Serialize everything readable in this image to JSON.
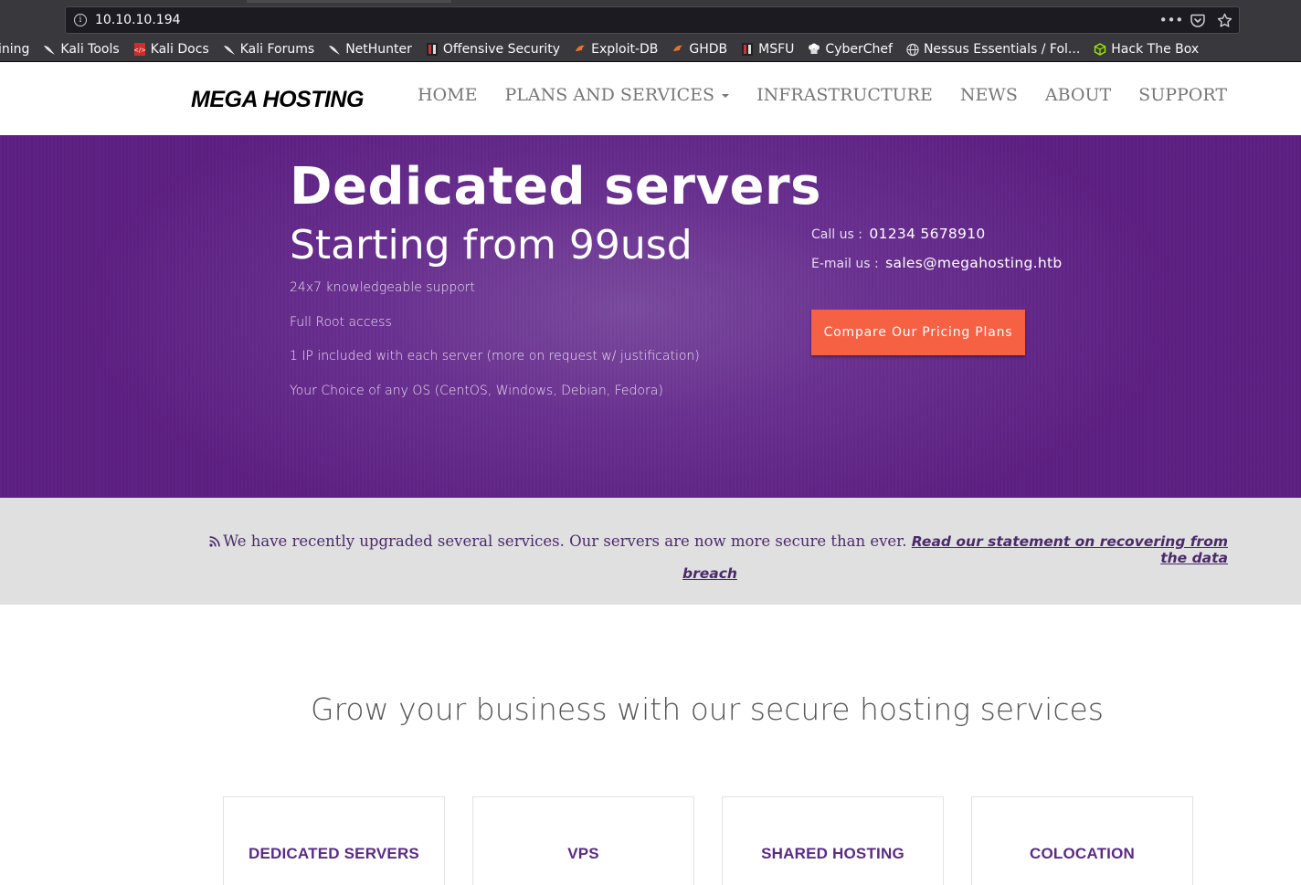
{
  "browser": {
    "url": "10.10.10.194",
    "actions": {
      "more": "•••",
      "pocket": "pocket-icon",
      "star": "☆"
    },
    "bookmarks": [
      {
        "label": "ining",
        "icon": "none"
      },
      {
        "label": "Kali Tools",
        "icon": "kali-dragon-icon"
      },
      {
        "label": "Kali Docs",
        "icon": "kali-docs-icon"
      },
      {
        "label": "Kali Forums",
        "icon": "kali-dragon-icon"
      },
      {
        "label": "NetHunter",
        "icon": "kali-dragon-icon"
      },
      {
        "label": "Offensive Security",
        "icon": "offsec-icon"
      },
      {
        "label": "Exploit-DB",
        "icon": "exploitdb-icon"
      },
      {
        "label": "GHDB",
        "icon": "exploitdb-icon"
      },
      {
        "label": "MSFU",
        "icon": "offsec-icon"
      },
      {
        "label": "CyberChef",
        "icon": "chef-icon"
      },
      {
        "label": "Nessus Essentials / Fol...",
        "icon": "globe-icon"
      },
      {
        "label": "Hack The Box",
        "icon": "htb-cube-icon"
      }
    ]
  },
  "site": {
    "logo": "MEGA HOSTING",
    "nav": {
      "home": "HOME",
      "plans": "PLANS AND SERVICES",
      "infrastructure": "INFRASTRUCTURE",
      "news": "NEWS",
      "about": "ABOUT",
      "support": "SUPPORT"
    }
  },
  "hero": {
    "title": "Dedicated servers",
    "subtitle": "Starting from 99usd",
    "features": [
      "24x7 knowledgeable support",
      "Full Root access",
      "1 IP included with each server (more on request w/ justification)",
      "Your Choice of any OS (CentOS, Windows, Debian, Fedora)"
    ],
    "call_label": "Call us :",
    "call_value": "01234 5678910",
    "email_label": "E-mail us :",
    "email_value": "sales@megahosting.htb",
    "cta": "Compare Our Pricing Plans"
  },
  "notice": {
    "text": "We have recently upgraded several services. Our servers are now more secure than ever.",
    "link_line1": "Read our statement on recovering from the data",
    "link_line2": "breach"
  },
  "services": {
    "title": "Grow your business with our secure hosting services",
    "cards": [
      "DEDICATED SERVERS",
      "VPS",
      "SHARED HOSTING",
      "COLOCATION"
    ]
  },
  "colors": {
    "hero_purple": "#5c1f82",
    "cta_orange": "#f76143",
    "card_text": "#5b2a86",
    "chrome_bg": "#38383d"
  }
}
